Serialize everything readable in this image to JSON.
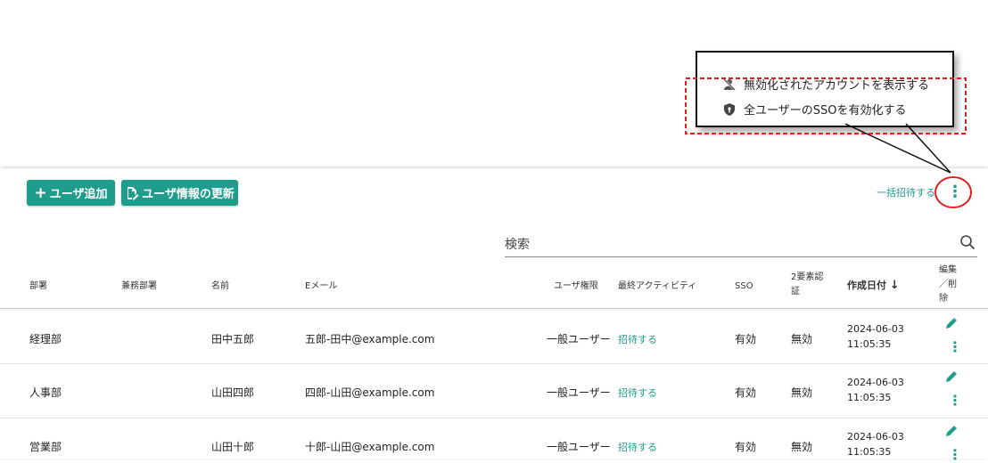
{
  "toolbar": {
    "add_user_label": "ユーザ追加",
    "update_user_label": "ユーザ情報の更新",
    "bulk_invite_label": "一括招待する"
  },
  "menu": {
    "items": [
      {
        "label": "無効化されたアカウントを表示する",
        "icon": "person-off-icon"
      },
      {
        "label": "全ユーザーのSSOを有効化する",
        "icon": "shield-icon"
      }
    ]
  },
  "search": {
    "label": "検索"
  },
  "table": {
    "headers": {
      "dept": "部署",
      "sub_dept": "兼務部署",
      "name": "名前",
      "email": "Eメール",
      "role": "ユーザ権限",
      "last_activity": "最終アクティビティ",
      "sso": "SSO",
      "twofa_line1": "2要素認",
      "twofa_line2": "証",
      "created": "作成日付",
      "created_sort": "↓",
      "edit_line1": "編集",
      "edit_line2": "／削",
      "edit_line3": "除"
    },
    "rows": [
      {
        "dept": "経理部",
        "sub_dept": "",
        "name": "田中五郎",
        "email": "五郎-田中@example.com",
        "role": "一般ユーザー",
        "activity": "招待する",
        "sso": "有効",
        "twofa": "無効",
        "date": "2024-06-03",
        "time": "11:05:35"
      },
      {
        "dept": "人事部",
        "sub_dept": "",
        "name": "山田四郎",
        "email": "四郎-山田@example.com",
        "role": "一般ユーザー",
        "activity": "招待する",
        "sso": "有効",
        "twofa": "無効",
        "date": "2024-06-03",
        "time": "11:05:35"
      },
      {
        "dept": "営業部",
        "sub_dept": "",
        "name": "山田十郎",
        "email": "十郎-山田@example.com",
        "role": "一般ユーザー",
        "activity": "招待する",
        "sso": "有効",
        "twofa": "無効",
        "date": "2024-06-03",
        "time": "11:05:35"
      }
    ]
  },
  "colors": {
    "accent": "#1f9d8c",
    "highlight_red": "#e02020"
  }
}
